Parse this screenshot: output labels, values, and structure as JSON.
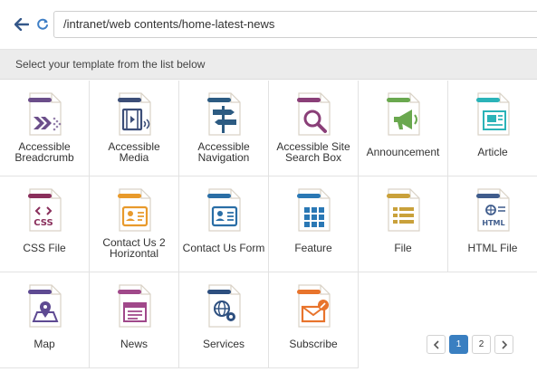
{
  "browser": {
    "address": "/intranet/web contents/home-latest-news",
    "back_icon": "arrow-left-icon",
    "refresh_icon": "refresh-icon"
  },
  "chooser": {
    "prompt": "Select your template from the list below",
    "templates": [
      {
        "label": "Accessible Breadcrumb",
        "icon": "breadcrumb-icon",
        "color": "#6b4e8a"
      },
      {
        "label": "Accessible Media",
        "icon": "media-icon",
        "color": "#3c4e78"
      },
      {
        "label": "Accessible Navigation",
        "icon": "signpost-icon",
        "color": "#2c5b82"
      },
      {
        "label": "Accessible Site Search Box",
        "icon": "magnifier-icon",
        "color": "#8a3f78"
      },
      {
        "label": "Announcement",
        "icon": "megaphone-icon",
        "color": "#6aa84f"
      },
      {
        "label": "Article",
        "icon": "newspaper-icon",
        "color": "#2bb3b8"
      },
      {
        "label": "CSS File",
        "icon": "css-file-icon",
        "color": "#8a2f5c"
      },
      {
        "label": "Contact Us 2 Horizontal",
        "icon": "contact-card-icon",
        "color": "#e89a2c"
      },
      {
        "label": "Contact Us Form",
        "icon": "contact-form-icon",
        "color": "#2a6ea6"
      },
      {
        "label": "Feature",
        "icon": "grid-icon",
        "color": "#2a78b5"
      },
      {
        "label": "File",
        "icon": "list-file-icon",
        "color": "#c9a13b"
      },
      {
        "label": "HTML File",
        "icon": "html-file-icon",
        "color": "#3f5c8c"
      },
      {
        "label": "Map",
        "icon": "map-pin-icon",
        "color": "#5e4a92"
      },
      {
        "label": "News",
        "icon": "news-icon",
        "color": "#a0488a"
      },
      {
        "label": "Services",
        "icon": "globe-gear-icon",
        "color": "#2d4f7f"
      },
      {
        "label": "Subscribe",
        "icon": "envelope-pen-icon",
        "color": "#e8742c"
      }
    ]
  },
  "pagination": {
    "prev_icon": "chevron-left-icon",
    "next_icon": "chevron-right-icon",
    "pages": [
      "1",
      "2"
    ],
    "active_page": "1"
  }
}
